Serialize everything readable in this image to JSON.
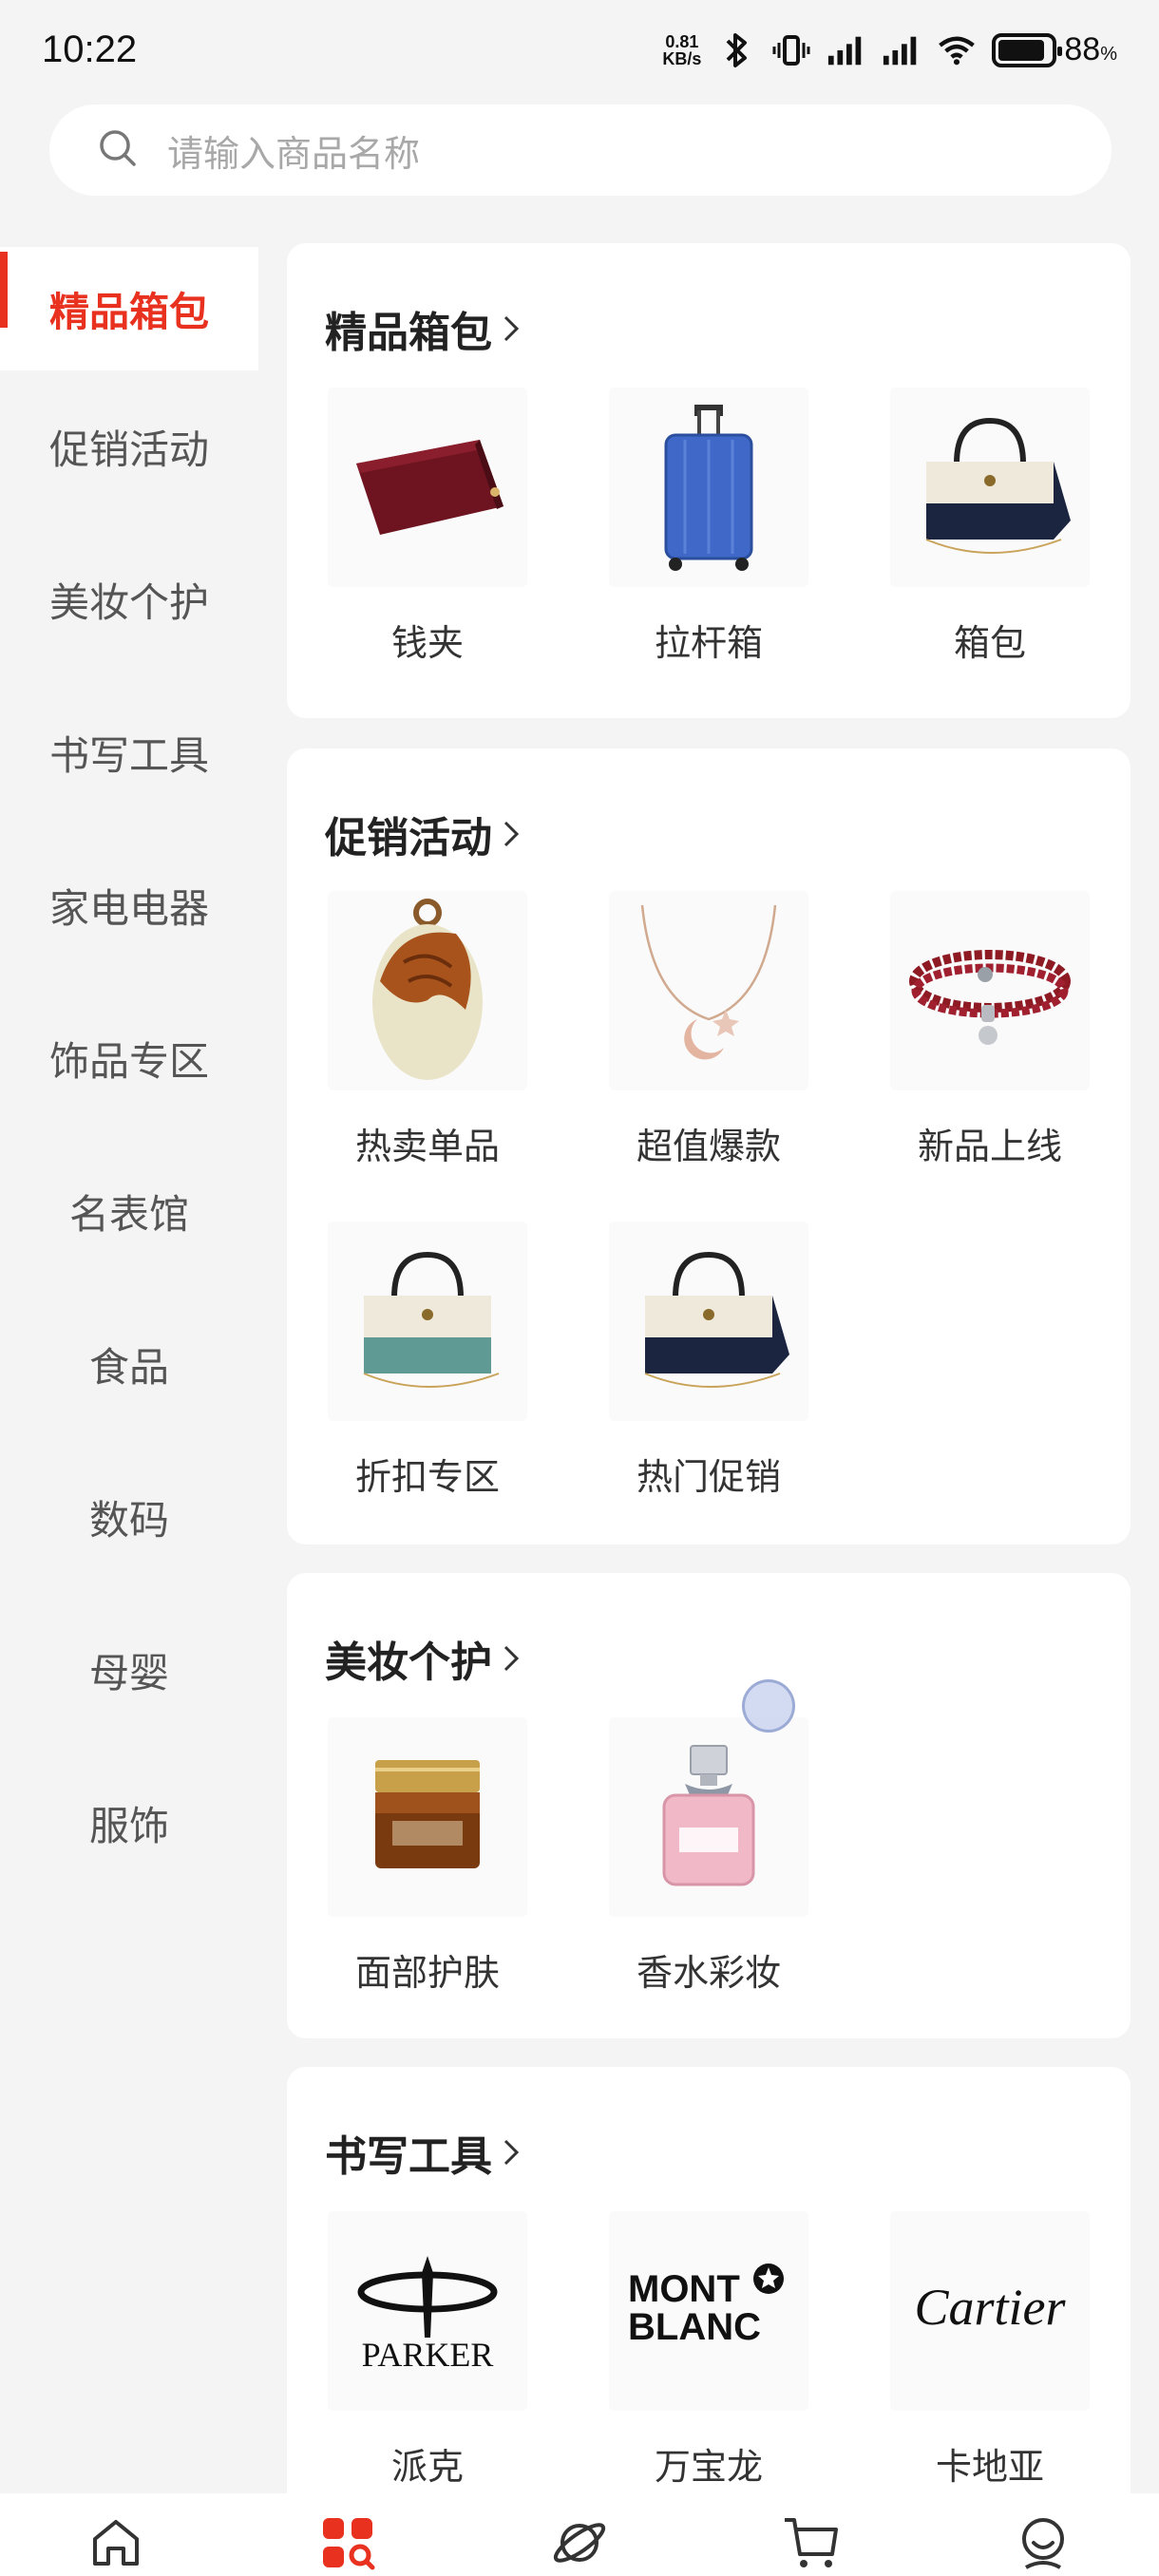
{
  "status_bar": {
    "time": "10:22",
    "net_speed_value": "0.81",
    "net_speed_unit": "KB/s",
    "battery_percent": "88",
    "battery_suffix": "%",
    "battery_level": 0.88,
    "icons": [
      "bluetooth-icon",
      "vibrate-icon",
      "signal-icon",
      "signal-icon",
      "wifi-icon",
      "battery-icon"
    ]
  },
  "search": {
    "placeholder": "请输入商品名称"
  },
  "sidebar": {
    "items": [
      {
        "label": "精品箱包",
        "active": true
      },
      {
        "label": "促销活动"
      },
      {
        "label": "美妆个护"
      },
      {
        "label": "书写工具"
      },
      {
        "label": "家电电器"
      },
      {
        "label": "饰品专区"
      },
      {
        "label": "名表馆"
      },
      {
        "label": "食品"
      },
      {
        "label": "数码"
      },
      {
        "label": "母婴"
      },
      {
        "label": "服饰"
      }
    ]
  },
  "sections": [
    {
      "title": "精品箱包",
      "items": [
        {
          "label": "钱夹",
          "image": "wallet"
        },
        {
          "label": "拉杆箱",
          "image": "suitcase"
        },
        {
          "label": "箱包",
          "image": "handbag-navy"
        }
      ]
    },
    {
      "title": "促销活动",
      "items": [
        {
          "label": "热卖单品",
          "image": "jade-pendant"
        },
        {
          "label": "超值爆款",
          "image": "necklace"
        },
        {
          "label": "新品上线",
          "image": "bracelet"
        },
        {
          "label": "折扣专区",
          "image": "handbag-teal"
        },
        {
          "label": "热门促销",
          "image": "handbag-navy"
        }
      ]
    },
    {
      "title": "美妆个护",
      "items": [
        {
          "label": "面部护肤",
          "image": "serum-jar"
        },
        {
          "label": "香水彩妆",
          "image": "perfume"
        }
      ]
    },
    {
      "title": "书写工具",
      "items": [
        {
          "label": "派克",
          "image": "parker-logo",
          "logo_text": "PARKER"
        },
        {
          "label": "万宝龙",
          "image": "montblanc-logo",
          "logo_text": "MONT BLANC"
        },
        {
          "label": "卡地亚",
          "image": "cartier-logo",
          "logo_text": "Cartier"
        }
      ]
    }
  ],
  "bottom_nav": {
    "items": [
      {
        "icon": "home-icon",
        "active": false
      },
      {
        "icon": "category-icon",
        "active": true
      },
      {
        "icon": "planet-icon",
        "active": false
      },
      {
        "icon": "cart-icon",
        "active": false
      },
      {
        "icon": "profile-icon",
        "active": false
      }
    ]
  },
  "colors": {
    "accent": "#e8311f",
    "background": "#f4f4f4"
  }
}
